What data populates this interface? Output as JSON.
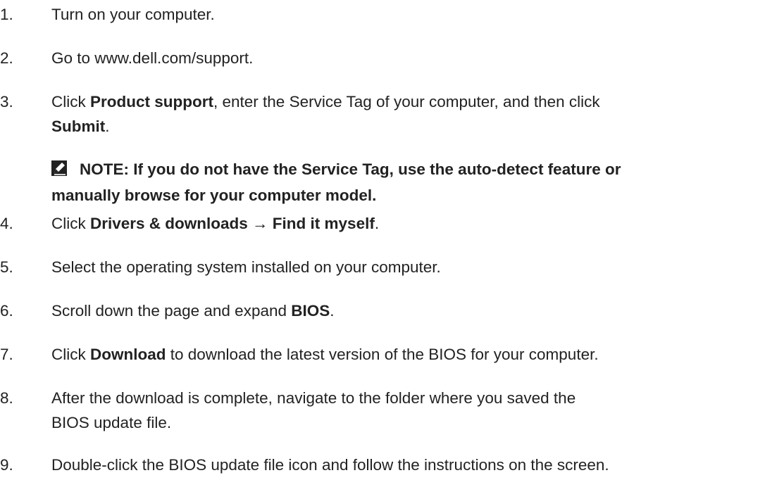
{
  "steps": [
    {
      "num": "1.",
      "text": "Turn on your computer."
    },
    {
      "num": "2.",
      "text": "Go to www.dell.com/support."
    },
    {
      "num": "3.",
      "pre": "Click ",
      "b1": "Product support",
      "mid": ", enter the Service Tag of your computer, and then click",
      "b2": "Submit",
      "post": "."
    },
    {
      "num": "4.",
      "pre": "Click ",
      "b1": "Drivers & downloads → Find it myself",
      "post": "."
    },
    {
      "num": "5.",
      "text": "Select the operating system installed on your computer."
    },
    {
      "num": "6.",
      "pre": "Scroll down the page and expand ",
      "b1": "BIOS",
      "post": "."
    },
    {
      "num": "7.",
      "pre": "Click ",
      "b1": "Download",
      "post": " to download the latest version of the BIOS for your computer."
    },
    {
      "num": "8.",
      "line1": "After the download is complete, navigate to the folder where you saved the",
      "line2": "BIOS update file."
    },
    {
      "num": "9.",
      "text": "Double-click the BIOS update file icon and follow the instructions on the screen."
    }
  ],
  "note": {
    "icon": "note-pencil-icon",
    "line1": "NOTE: If you do not have the Service Tag, use the auto-detect feature or",
    "line2": "manually browse for your computer model."
  }
}
